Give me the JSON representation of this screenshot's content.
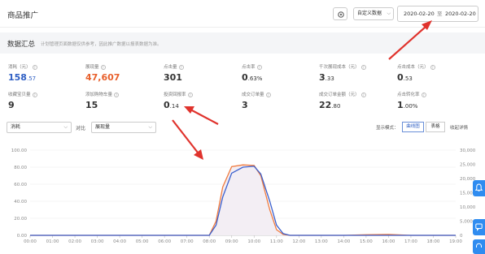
{
  "header": {
    "title": "商品推广",
    "custom_data_label": "自定义数据",
    "date_start": "2020-02-20",
    "date_sep": "至",
    "date_end": "2020-02-20"
  },
  "summary": {
    "title": "数据汇总",
    "note": "计划管理页面数据仅供参考，因此推广数据以报表数据为准。"
  },
  "metrics": [
    {
      "label": "消耗（元）",
      "int": "158",
      "dec": ".57",
      "color": "blue"
    },
    {
      "label": "展现量",
      "int": "47,607",
      "dec": "",
      "color": "orange"
    },
    {
      "label": "点击量",
      "int": "301",
      "dec": "",
      "color": ""
    },
    {
      "label": "点击率",
      "int": "0",
      "dec": ".63%",
      "color": ""
    },
    {
      "label": "千次展现成本（元）",
      "int": "3",
      "dec": ".33",
      "color": ""
    },
    {
      "label": "点击成本（元）",
      "int": "0",
      "dec": ".53",
      "color": ""
    },
    {
      "label": "收藏宝贝量",
      "int": "9",
      "dec": "",
      "color": ""
    },
    {
      "label": "添加购物车量",
      "int": "15",
      "dec": "",
      "color": ""
    },
    {
      "label": "投资回报率",
      "int": "0",
      "dec": ".14",
      "color": ""
    },
    {
      "label": "成交订单量",
      "int": "3",
      "dec": "",
      "color": ""
    },
    {
      "label": "成交订单金额（元）",
      "int": "22",
      "dec": ".80",
      "color": ""
    },
    {
      "label": "点击转化率",
      "int": "1",
      "dec": ".00%",
      "color": ""
    }
  ],
  "controls": {
    "metric_left": "消耗",
    "compare_label": "对比",
    "metric_right": "展现量",
    "mode_label": "显示模式：",
    "mode_chart": "曲线图",
    "mode_table": "表格",
    "collapse": "收起详情"
  },
  "colors": {
    "blue": "#3a5fcd",
    "orange": "#f07b3f",
    "fill": "#f3eef4",
    "grid": "#e9e9e9",
    "float": "#2f8cf0"
  },
  "chart_data": {
    "type": "line",
    "x": [
      "00:00",
      "01:00",
      "02:00",
      "03:00",
      "04:00",
      "05:00",
      "06:00",
      "07:00",
      "08:00",
      "09:00",
      "10:00",
      "11:00",
      "12:00",
      "13:00",
      "14:00",
      "15:00",
      "16:00",
      "17:00",
      "18:00",
      "19:00"
    ],
    "y_left_ticks": [
      "100.00",
      "80.00",
      "60.00",
      "40.00",
      "20.00",
      "0.00"
    ],
    "y_right_ticks": [
      "30,000",
      "25,000",
      "20,000",
      "15,000",
      "10,000",
      "5,000",
      "0"
    ],
    "left_ylim": [
      0,
      100
    ],
    "right_ylim": [
      0,
      30000
    ],
    "series": [
      {
        "name": "消耗",
        "axis": "left",
        "color": "blue",
        "x": [
          0,
          1,
          2,
          3,
          4,
          5,
          6,
          7,
          8,
          8.3,
          8.6,
          9,
          9.5,
          10,
          10.3,
          10.7,
          11,
          11.3,
          11.6,
          12,
          13,
          14,
          15,
          16,
          17,
          18,
          19
        ],
        "y": [
          0,
          0,
          0,
          0,
          0,
          0,
          0,
          0,
          0,
          12,
          45,
          73,
          80,
          81,
          72,
          40,
          12,
          2,
          0,
          0,
          0,
          0,
          0,
          0,
          0,
          0,
          0
        ]
      },
      {
        "name": "展现量",
        "axis": "right",
        "color": "orange",
        "x": [
          0,
          1,
          2,
          3,
          4,
          5,
          6,
          7,
          8,
          8.3,
          8.6,
          9,
          9.5,
          10,
          10.3,
          10.7,
          11,
          11.3,
          11.6,
          12,
          13,
          14,
          15,
          16,
          17,
          18,
          19
        ],
        "y": [
          0,
          0,
          0,
          0,
          0,
          0,
          0,
          0,
          0,
          5000,
          17000,
          24200,
          24800,
          24600,
          21000,
          9000,
          2000,
          300,
          0,
          0,
          0,
          0,
          200,
          300,
          0,
          0,
          0
        ]
      }
    ]
  }
}
